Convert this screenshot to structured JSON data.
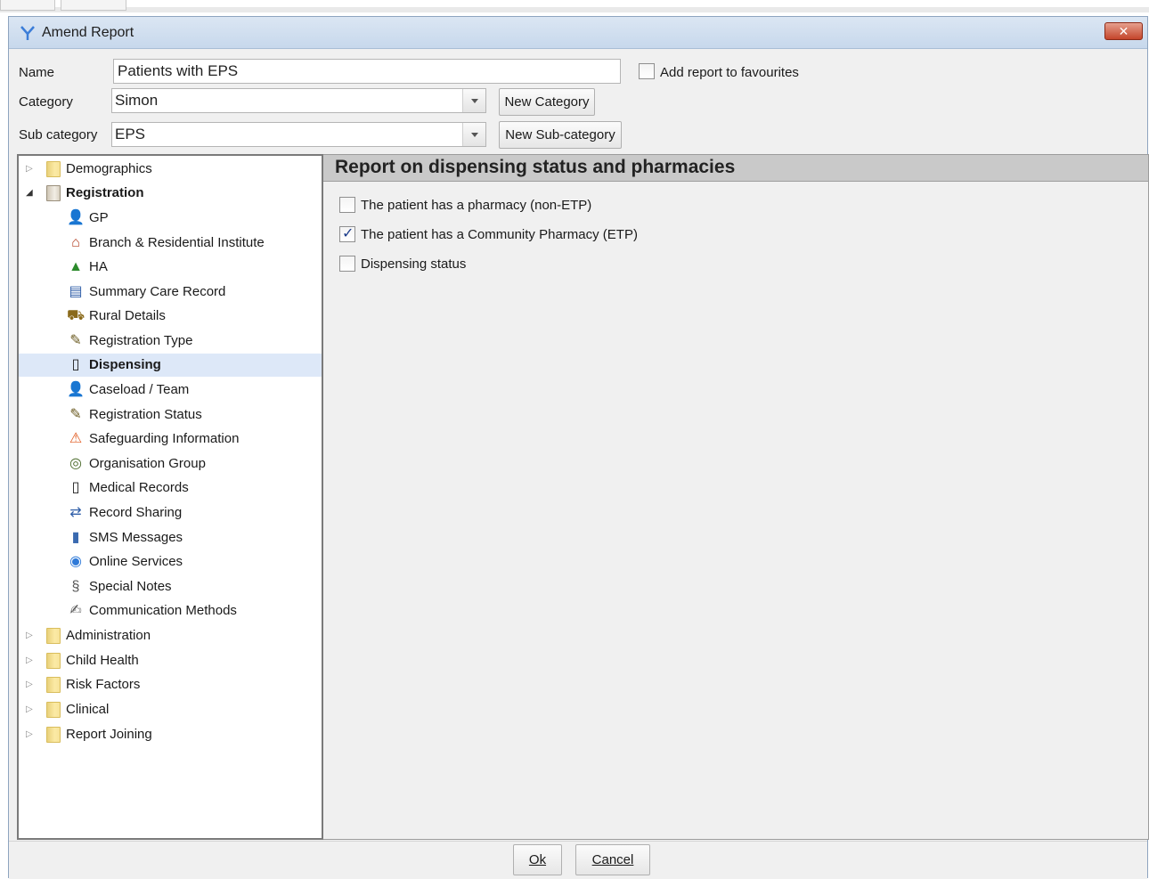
{
  "window": {
    "title": "Amend Report",
    "close_label": "✕"
  },
  "form": {
    "name_label": "Name",
    "name_value": "Patients with EPS",
    "favourites_label": "Add report to favourites",
    "category_label": "Category",
    "category_value": "Simon",
    "new_category_label": "New Category",
    "subcategory_label": "Sub category",
    "subcategory_value": "EPS",
    "new_subcategory_label": "New Sub-category"
  },
  "tree": {
    "demographics": "Demographics",
    "registration": "Registration",
    "items": [
      {
        "label": "GP",
        "icon": "person-icon"
      },
      {
        "label": "Branch & Residential Institute",
        "icon": "house-icon"
      },
      {
        "label": "HA",
        "icon": "ha-icon"
      },
      {
        "label": "Summary Care Record",
        "icon": "record-icon"
      },
      {
        "label": "Rural Details",
        "icon": "car-icon"
      },
      {
        "label": "Registration Type",
        "icon": "notepad-icon"
      },
      {
        "label": "Dispensing",
        "icon": "bottle-icon"
      },
      {
        "label": "Caseload / Team",
        "icon": "person-icon"
      },
      {
        "label": "Registration Status",
        "icon": "notepad-icon"
      },
      {
        "label": "Safeguarding Information",
        "icon": "warning-icon"
      },
      {
        "label": "Organisation Group",
        "icon": "organisation-icon"
      },
      {
        "label": "Medical Records",
        "icon": "folder-file-icon"
      },
      {
        "label": "Record Sharing",
        "icon": "share-icon"
      },
      {
        "label": "SMS Messages",
        "icon": "phone-icon"
      },
      {
        "label": "Online Services",
        "icon": "globe-icon"
      },
      {
        "label": "Special Notes",
        "icon": "notes-icon"
      },
      {
        "label": "Communication Methods",
        "icon": "pen-icon"
      }
    ],
    "groups": [
      "Administration",
      "Child Health",
      "Risk Factors",
      "Clinical",
      "Report Joining"
    ]
  },
  "content": {
    "title": "Report on dispensing status and pharmacies",
    "options": [
      {
        "label": "The patient has a pharmacy (non-ETP)",
        "checked": false
      },
      {
        "label": "The patient has a Community Pharmacy (ETP)",
        "checked": true
      },
      {
        "label": "Dispensing status",
        "checked": false
      }
    ]
  },
  "buttons": {
    "ok": "Ok",
    "cancel": "Cancel"
  }
}
